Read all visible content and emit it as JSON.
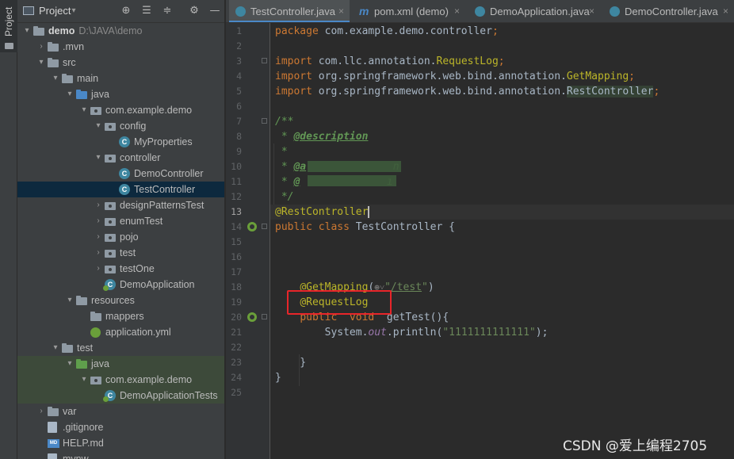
{
  "sidebar_strip": {
    "label": "Project"
  },
  "project_panel": {
    "title": "Project",
    "toolbar_icons": [
      "crosshair-icon",
      "expand-all-icon",
      "collapse-all-icon",
      "gear-icon",
      "minimize-icon"
    ],
    "tree": [
      {
        "label": "demo",
        "path": "D:\\JAVA\\demo",
        "arrow": "▾",
        "icon": "folder",
        "indent": 0,
        "bold": true
      },
      {
        "label": ".mvn",
        "arrow": "›",
        "icon": "folder",
        "indent": 1
      },
      {
        "label": "src",
        "arrow": "▾",
        "icon": "folder",
        "indent": 1
      },
      {
        "label": "main",
        "arrow": "▾",
        "icon": "folder",
        "indent": 2
      },
      {
        "label": "java",
        "arrow": "▾",
        "icon": "folder-blue",
        "indent": 3
      },
      {
        "label": "com.example.demo",
        "arrow": "▾",
        "icon": "package",
        "indent": 4
      },
      {
        "label": "config",
        "arrow": "▾",
        "icon": "package",
        "indent": 5
      },
      {
        "label": "MyProperties",
        "arrow": "",
        "icon": "class",
        "indent": 6
      },
      {
        "label": "controller",
        "arrow": "▾",
        "icon": "package",
        "indent": 5
      },
      {
        "label": "DemoController",
        "arrow": "",
        "icon": "class",
        "indent": 6
      },
      {
        "label": "TestController",
        "arrow": "",
        "icon": "class",
        "indent": 6,
        "selected": true
      },
      {
        "label": "designPatternsTest",
        "arrow": "›",
        "icon": "package",
        "indent": 5
      },
      {
        "label": "enumTest",
        "arrow": "›",
        "icon": "package",
        "indent": 5
      },
      {
        "label": "pojo",
        "arrow": "›",
        "icon": "package",
        "indent": 5
      },
      {
        "label": "test",
        "arrow": "›",
        "icon": "package",
        "indent": 5
      },
      {
        "label": "testOne",
        "arrow": "›",
        "icon": "package",
        "indent": 5
      },
      {
        "label": "DemoApplication",
        "arrow": "",
        "icon": "class-spring",
        "indent": 5
      },
      {
        "label": "resources",
        "arrow": "▾",
        "icon": "folder-res",
        "indent": 3
      },
      {
        "label": "mappers",
        "arrow": "",
        "icon": "folder",
        "indent": 4
      },
      {
        "label": "application.yml",
        "arrow": "",
        "icon": "yml",
        "indent": 4
      },
      {
        "label": "test",
        "arrow": "▾",
        "icon": "folder",
        "indent": 2
      },
      {
        "label": "java",
        "arrow": "▾",
        "icon": "folder-green",
        "indent": 3,
        "green": true
      },
      {
        "label": "com.example.demo",
        "arrow": "▾",
        "icon": "package",
        "indent": 4,
        "green": true
      },
      {
        "label": "DemoApplicationTests",
        "arrow": "",
        "icon": "class-spring",
        "indent": 5,
        "green": true
      },
      {
        "label": "var",
        "arrow": "›",
        "icon": "folder",
        "indent": 1
      },
      {
        "label": ".gitignore",
        "arrow": "",
        "icon": "file",
        "indent": 1
      },
      {
        "label": "HELP.md",
        "arrow": "",
        "icon": "md",
        "indent": 1
      },
      {
        "label": "mvnw",
        "arrow": "",
        "icon": "file",
        "indent": 1
      }
    ]
  },
  "editor_tabs": [
    {
      "label": "TestController.java",
      "icon": "class",
      "active": true
    },
    {
      "label": "pom.xml (demo)",
      "icon": "maven"
    },
    {
      "label": "DemoApplication.java",
      "icon": "class"
    },
    {
      "label": "DemoController.java",
      "icon": "class"
    }
  ],
  "editor": {
    "current_line": 13,
    "line_numbers": [
      "1",
      "2",
      "3",
      "4",
      "5",
      "6",
      "7",
      "8",
      "9",
      "10",
      "11",
      "12",
      "13",
      "14",
      "15",
      "16",
      "17",
      "18",
      "19",
      "20",
      "21",
      "22",
      "23",
      "24",
      "25"
    ],
    "lines": [
      [
        {
          "t": "package ",
          "c": "kw"
        },
        {
          "t": "com.example.demo.controller"
        },
        {
          "t": ";",
          "c": "kw"
        }
      ],
      [],
      [
        {
          "t": "import ",
          "c": "kw"
        },
        {
          "t": "com.llc.annotation."
        },
        {
          "t": "RequestLog",
          "c": "an"
        },
        {
          "t": ";",
          "c": "kw"
        }
      ],
      [
        {
          "t": "import ",
          "c": "kw"
        },
        {
          "t": "org.springframework.web.bind.annotation."
        },
        {
          "t": "GetMapping",
          "c": "an"
        },
        {
          "t": ";",
          "c": "kw"
        }
      ],
      [
        {
          "t": "import ",
          "c": "kw"
        },
        {
          "t": "org.springframework.web.bind.annotation."
        },
        {
          "t": "RestController",
          "c": "hl"
        },
        {
          "t": ";",
          "c": "kw"
        }
      ],
      [],
      [
        {
          "t": "/**",
          "c": "cm"
        }
      ],
      [
        {
          "t": " * ",
          "c": "cm"
        },
        {
          "t": "@description",
          "c": "tag"
        }
      ],
      [
        {
          "t": " *",
          "c": "cm"
        }
      ],
      [
        {
          "t": " * ",
          "c": "cm"
        },
        {
          "t": "@a",
          "c": "tag"
        },
        {
          "t": "              n",
          "c": "cm"
        }
      ],
      [
        {
          "t": " * ",
          "c": "cm"
        },
        {
          "t": "@",
          "c": "tag"
        },
        {
          "t": "              ı",
          "c": "cm"
        }
      ],
      [
        {
          "t": " */",
          "c": "cm"
        }
      ],
      [
        {
          "t": "@RestController",
          "c": "an caret"
        }
      ],
      [
        {
          "t": "public ",
          "c": "kw"
        },
        {
          "t": "class ",
          "c": "kw"
        },
        {
          "t": "TestController {"
        }
      ],
      [],
      [],
      [],
      [
        {
          "t": "    "
        },
        {
          "t": "@GetMapping",
          "c": "an"
        },
        {
          "t": "("
        },
        {
          "t": "⊕˅",
          "c": "glyph"
        },
        {
          "t": "\"",
          "c": "st"
        },
        {
          "t": "/test",
          "c": "st ul"
        },
        {
          "t": "\"",
          "c": "st"
        },
        {
          "t": ")"
        }
      ],
      [
        {
          "t": "    "
        },
        {
          "t": "@RequestLog",
          "c": "an"
        }
      ],
      [
        {
          "t": "    "
        },
        {
          "t": "public  void  ",
          "c": "kw"
        },
        {
          "t": "getTest(){"
        }
      ],
      [
        {
          "t": "        System."
        },
        {
          "t": "out",
          "c": "fld"
        },
        {
          "t": ".println("
        },
        {
          "t": "\"1111111111111\"",
          "c": "st"
        },
        {
          "t": ");"
        }
      ],
      [],
      [
        {
          "t": "    }"
        }
      ],
      [
        {
          "t": "}"
        }
      ],
      []
    ],
    "gutter_icons": [
      {
        "line": 14,
        "name": "spring-bean-icon"
      },
      {
        "line": 20,
        "name": "spring-mapping-icon"
      }
    ]
  },
  "watermark": "CSDN @爱上编程2705",
  "colors": {
    "highlight_box": "#e8252a",
    "keyword": "#cc7832",
    "annotation": "#bbb529",
    "string": "#6a8759",
    "comment": "#629755"
  }
}
